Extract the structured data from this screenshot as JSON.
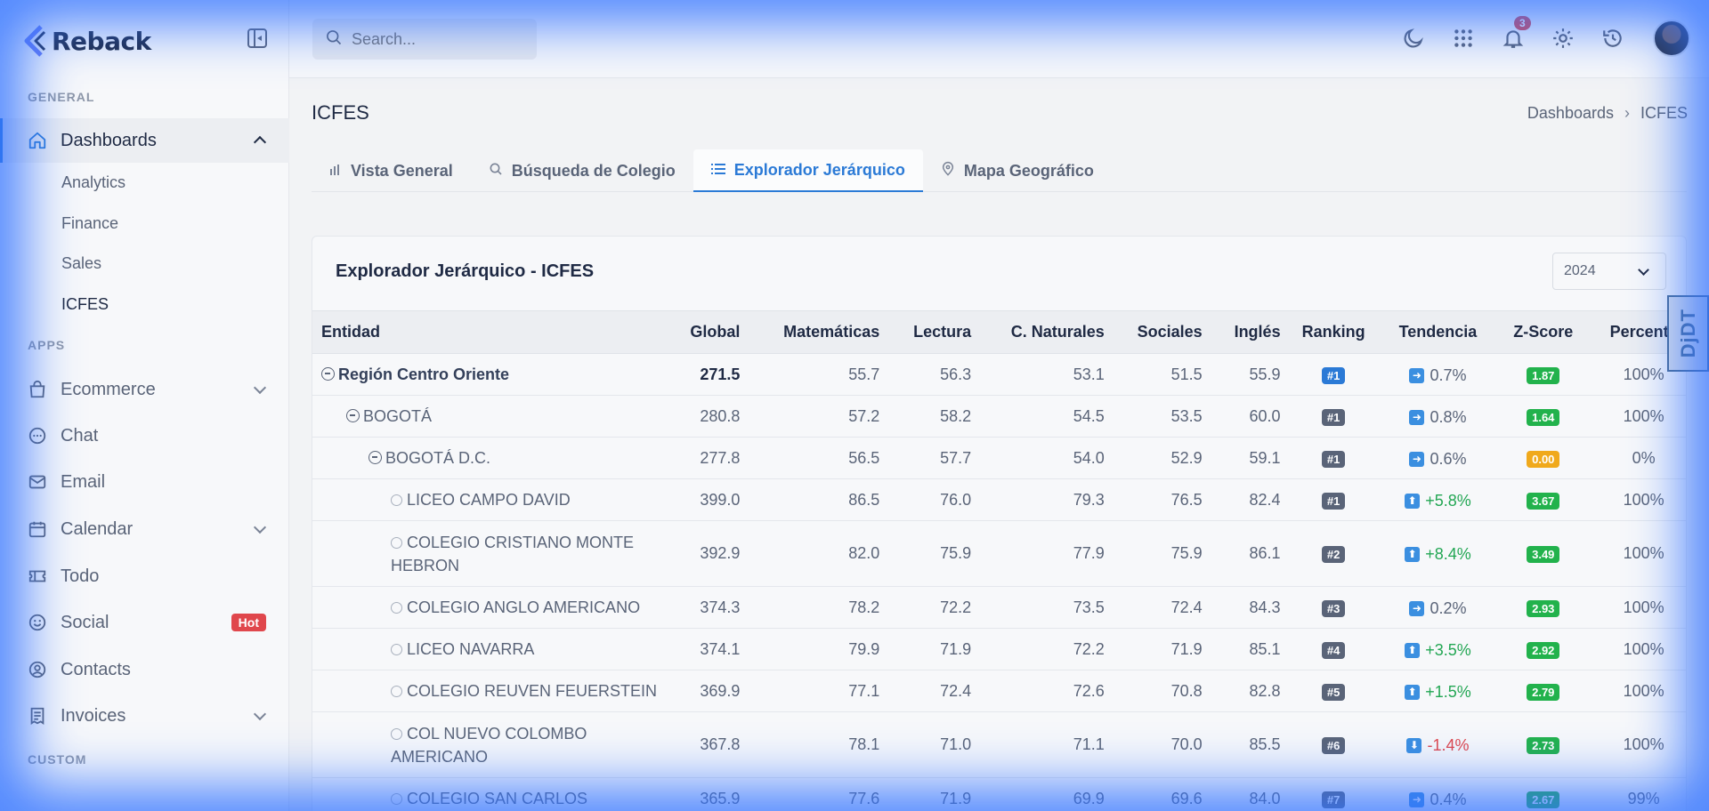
{
  "brand": {
    "name": "Reback"
  },
  "sidebar": {
    "section_general": "GENERAL",
    "section_apps": "APPS",
    "section_custom": "CUSTOM",
    "dashboards": {
      "label": "Dashboards",
      "icon": "home-icon"
    },
    "sub_items": [
      "Analytics",
      "Finance",
      "Sales",
      "ICFES"
    ],
    "apps": [
      {
        "label": "Ecommerce",
        "icon": "shopping-bag-icon"
      },
      {
        "label": "Chat",
        "icon": "chat-icon"
      },
      {
        "label": "Email",
        "icon": "mail-icon"
      },
      {
        "label": "Calendar",
        "icon": "calendar-icon"
      },
      {
        "label": "Todo",
        "icon": "ticket-icon"
      },
      {
        "label": "Social",
        "icon": "smile-icon",
        "badge": "Hot"
      },
      {
        "label": "Contacts",
        "icon": "user-circle-icon"
      },
      {
        "label": "Invoices",
        "icon": "receipt-icon"
      }
    ]
  },
  "topbar": {
    "search_placeholder": "Search...",
    "notification_count": "3"
  },
  "page": {
    "title": "ICFES",
    "breadcrumb": [
      "Dashboards",
      "ICFES"
    ]
  },
  "tabs": [
    {
      "label": "Vista General",
      "icon": "bar-chart-icon"
    },
    {
      "label": "Búsqueda de Colegio",
      "icon": "search-icon"
    },
    {
      "label": "Explorador Jerárquico",
      "icon": "list-icon"
    },
    {
      "label": "Mapa Geográfico",
      "icon": "map-pin-icon"
    }
  ],
  "card": {
    "title": "Explorador Jerárquico - ICFES",
    "year": "2024"
  },
  "table": {
    "headers": [
      "Entidad",
      "Global",
      "Matemáticas",
      "Lectura",
      "C. Naturales",
      "Sociales",
      "Inglés",
      "Ranking",
      "Tendencia",
      "Z-Score",
      "Percentil"
    ],
    "rows": [
      {
        "entity": "Región Centro Oriente",
        "global": "271.5",
        "mat": "55.7",
        "lec": "56.3",
        "nat": "53.1",
        "soc": "51.5",
        "ing": "55.9",
        "rank": "#1",
        "trend": "0.7%",
        "z": "1.87",
        "pct": "100%"
      },
      {
        "entity": "BOGOTÁ",
        "global": "280.8",
        "mat": "57.2",
        "lec": "58.2",
        "nat": "54.5",
        "soc": "53.5",
        "ing": "60.0",
        "rank": "#1",
        "trend": "0.8%",
        "z": "1.64",
        "pct": "100%"
      },
      {
        "entity": "BOGOTÁ D.C.",
        "global": "277.8",
        "mat": "56.5",
        "lec": "57.7",
        "nat": "54.0",
        "soc": "52.9",
        "ing": "59.1",
        "rank": "#1",
        "trend": "0.6%",
        "z": "0.00",
        "pct": "0%"
      },
      {
        "entity": "LICEO CAMPO DAVID",
        "global": "399.0",
        "mat": "86.5",
        "lec": "76.0",
        "nat": "79.3",
        "soc": "76.5",
        "ing": "82.4",
        "rank": "#1",
        "trend": "+5.8%",
        "z": "3.67",
        "pct": "100%"
      },
      {
        "entity": "COLEGIO CRISTIANO MONTE HEBRON",
        "global": "392.9",
        "mat": "82.0",
        "lec": "75.9",
        "nat": "77.9",
        "soc": "75.9",
        "ing": "86.1",
        "rank": "#2",
        "trend": "+8.4%",
        "z": "3.49",
        "pct": "100%"
      },
      {
        "entity": "COLEGIO ANGLO AMERICANO",
        "global": "374.3",
        "mat": "78.2",
        "lec": "72.2",
        "nat": "73.5",
        "soc": "72.4",
        "ing": "84.3",
        "rank": "#3",
        "trend": "0.2%",
        "z": "2.93",
        "pct": "100%"
      },
      {
        "entity": "LICEO NAVARRA",
        "global": "374.1",
        "mat": "79.9",
        "lec": "71.9",
        "nat": "72.2",
        "soc": "71.9",
        "ing": "85.1",
        "rank": "#4",
        "trend": "+3.5%",
        "z": "2.92",
        "pct": "100%"
      },
      {
        "entity": "COLEGIO REUVEN FEUERSTEIN",
        "global": "369.9",
        "mat": "77.1",
        "lec": "72.4",
        "nat": "72.6",
        "soc": "70.8",
        "ing": "82.8",
        "rank": "#5",
        "trend": "+1.5%",
        "z": "2.79",
        "pct": "100%"
      },
      {
        "entity": "COL NUEVO COLOMBO AMERICANO",
        "global": "367.8",
        "mat": "78.1",
        "lec": "71.0",
        "nat": "71.1",
        "soc": "70.0",
        "ing": "85.5",
        "rank": "#6",
        "trend": "-1.4%",
        "z": "2.73",
        "pct": "100%"
      },
      {
        "entity": "COLEGIO SAN CARLOS",
        "global": "365.9",
        "mat": "77.6",
        "lec": "71.9",
        "nat": "69.9",
        "soc": "69.6",
        "ing": "84.0",
        "rank": "#7",
        "trend": "0.4%",
        "z": "2.67",
        "pct": "99%"
      }
    ]
  },
  "side_widget": {
    "text": "DjDT"
  },
  "colors": {
    "accent": "#2b7ad6",
    "hot": "#e0474c",
    "up": "#22a653",
    "zscore": "#22b24c",
    "zwarn": "#f0a91c"
  }
}
